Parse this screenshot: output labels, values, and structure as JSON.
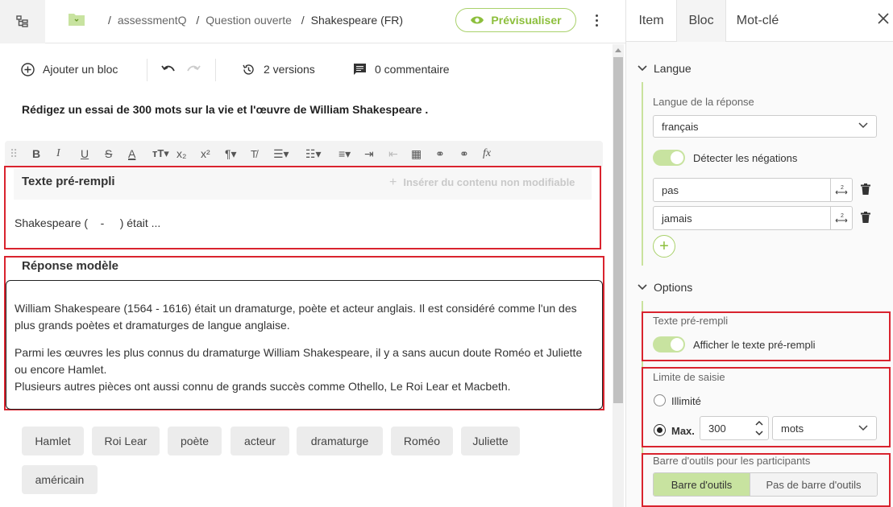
{
  "breadcrumb": {
    "items": [
      "assessmentQ",
      "Question ouverte",
      "Shakespeare (FR)"
    ]
  },
  "header": {
    "preview_label": "Prévisualiser"
  },
  "toolbar": {
    "add_block": "Ajouter un bloc",
    "versions": "2 versions",
    "comments": "0 commentaire"
  },
  "question": {
    "text": "Rédigez un essai de 300 mots sur la vie et l'œuvre de William Shakespeare ."
  },
  "prefilled": {
    "title": "Texte pré-rempli",
    "insert_label": "Insérer du contenu non modifiable",
    "content": "Shakespeare (    -     ) était ..."
  },
  "model_answer": {
    "title": "Réponse modèle",
    "paragraphs": [
      "William Shakespeare (1564 - 1616) était un dramaturge, poète et acteur anglais. Il est considéré comme l'un des plus grands poètes et dramaturges de langue anglaise.",
      "Parmi les œuvres les plus connus du dramaturge William Shakespeare, il y a sans aucun doute Roméo et Juliette ou encore Hamlet.",
      "Plusieurs autres pièces ont aussi connu de grands succès comme Othello, Le Roi Lear et Macbeth."
    ]
  },
  "keywords": [
    "Hamlet",
    "Roi Lear",
    "poète",
    "acteur",
    "dramaturge",
    "Roméo",
    "Juliette",
    "américain"
  ],
  "panel": {
    "tabs": [
      "Item",
      "Bloc",
      "Mot-clé"
    ],
    "active_tab": "Bloc",
    "langue": {
      "section": "Langue",
      "label": "Langue de la réponse",
      "value": "français",
      "detect_negations": "Détecter les négations",
      "negations": [
        "pas",
        "jamais"
      ]
    },
    "options": {
      "section": "Options",
      "prefilled_label": "Texte pré-rempli",
      "show_prefilled": "Afficher le texte pré-rempli",
      "limit_label": "Limite de saisie",
      "unlimited": "Illimité",
      "max": "Max.",
      "max_value": "300",
      "unit": "mots",
      "toolbar_label": "Barre d'outils pour les participants",
      "toolbar_on": "Barre d'outils",
      "toolbar_off": "Pas de barre d'outils"
    }
  },
  "colors": {
    "accent": "#8dbf3d",
    "accent_light": "#c8e3a0",
    "highlight": "#d9232e"
  }
}
